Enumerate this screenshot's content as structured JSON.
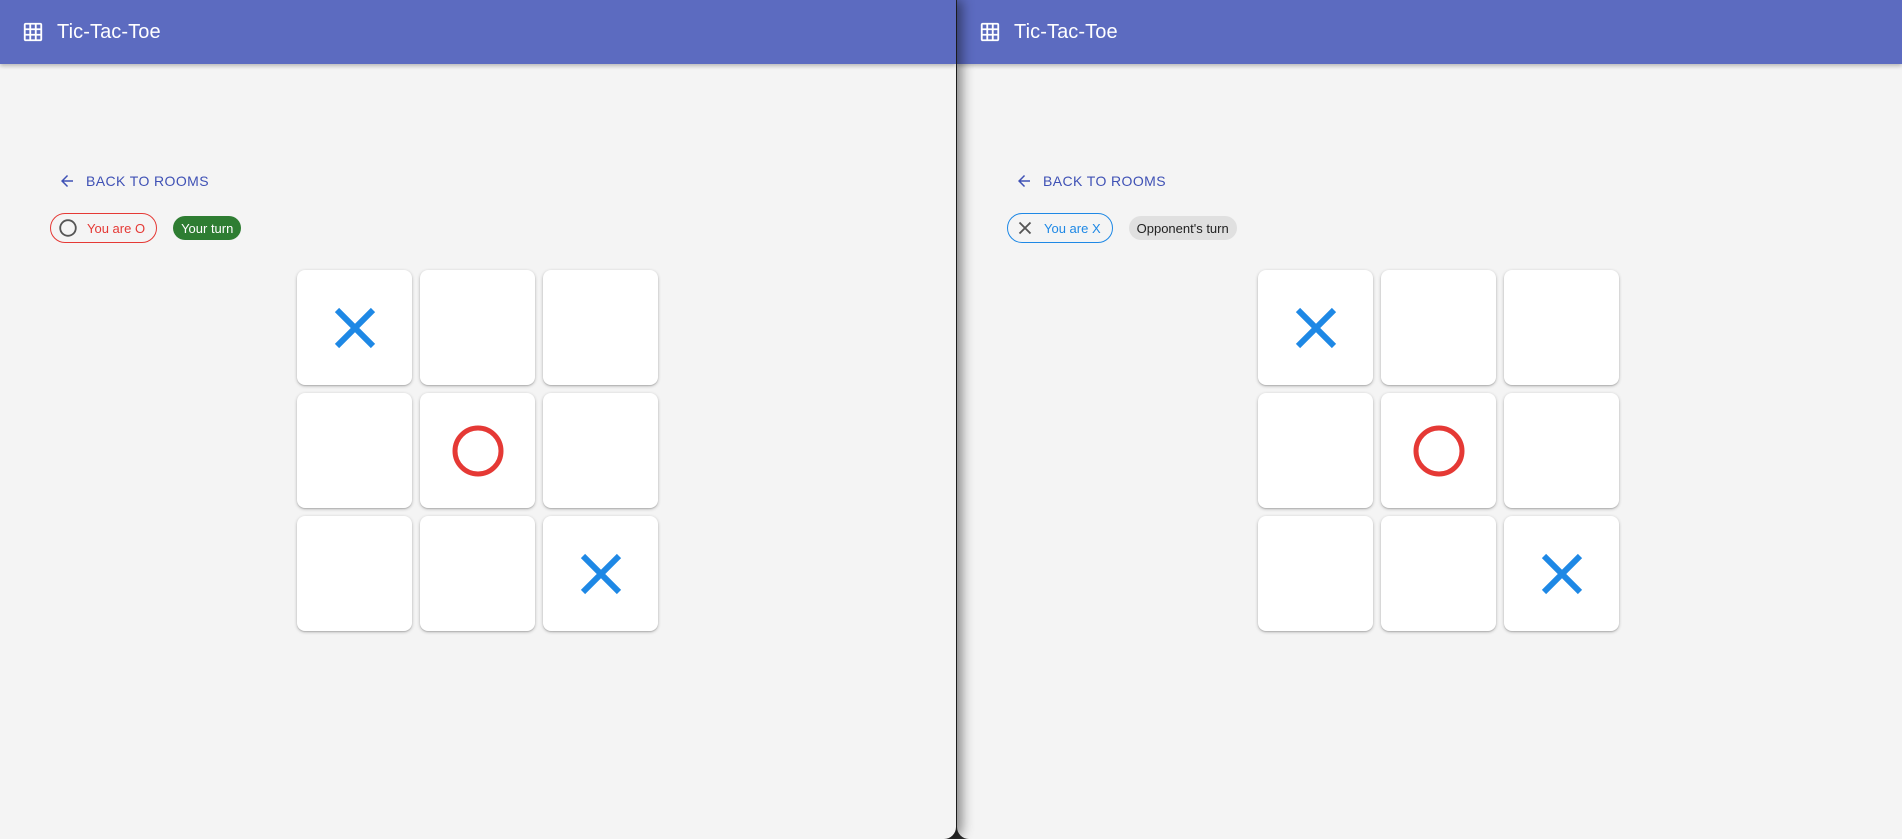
{
  "windows": [
    {
      "app_title": "Tic-Tac-Toe",
      "back_label": "BACK TO ROOMS",
      "role_label": "You are O",
      "role_mark": "O",
      "turn_label": "Your turn",
      "board": [
        "X",
        "",
        "",
        "",
        "O",
        "",
        "",
        "",
        "X"
      ]
    },
    {
      "app_title": "Tic-Tac-Toe",
      "back_label": "BACK TO ROOMS",
      "role_label": "You are X",
      "role_mark": "X",
      "turn_label": "Opponent's turn",
      "board": [
        "X",
        "",
        "",
        "",
        "O",
        "",
        "",
        "",
        "X"
      ]
    }
  ],
  "colors": {
    "appbar": "#5c6bc0",
    "x_mark": "#1e88e5",
    "o_mark": "#e53935",
    "your_turn": "#2e7d32"
  },
  "icons": {
    "appbar": "grid-icon",
    "back": "arrow-left-icon"
  }
}
